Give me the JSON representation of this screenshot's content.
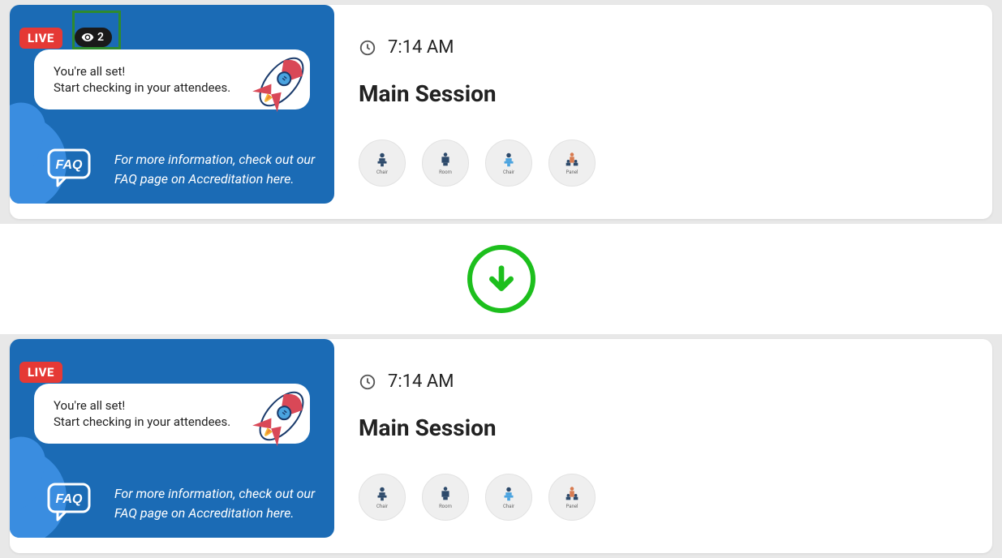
{
  "session1": {
    "live_label": "LIVE",
    "viewer_count": "2",
    "bubble_line1": "You're all set!",
    "bubble_line2": "Start checking in your attendees.",
    "faq_text": "For more information, check out our FAQ page on Accreditation here.",
    "time": "7:14 AM",
    "title": "Main Session",
    "speakers": {
      "s1": "Chair",
      "s2": "Room",
      "s3": "Chair",
      "s4": "Panel"
    }
  },
  "session2": {
    "live_label": "LIVE",
    "bubble_line1": "You're all set!",
    "bubble_line2": "Start checking in your attendees.",
    "faq_text": "For more information, check out our FAQ page on Accreditation here.",
    "time": "7:14 AM",
    "title": "Main Session",
    "speakers": {
      "s1": "Chair",
      "s2": "Room",
      "s3": "Chair",
      "s4": "Panel"
    }
  }
}
